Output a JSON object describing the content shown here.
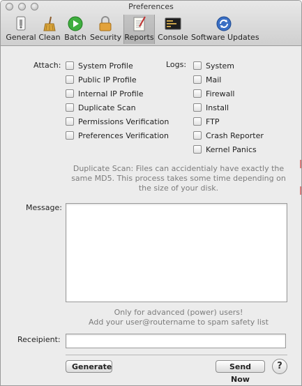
{
  "window": {
    "title": "Preferences"
  },
  "toolbar": {
    "items": [
      {
        "label": "General",
        "icon": "general-switch-icon"
      },
      {
        "label": "Clean",
        "icon": "broom-icon"
      },
      {
        "label": "Batch",
        "icon": "play-icon"
      },
      {
        "label": "Security",
        "icon": "lock-icon"
      },
      {
        "label": "Reports",
        "icon": "notepad-icon",
        "selected": true
      },
      {
        "label": "Console",
        "icon": "terminal-icon"
      },
      {
        "label": "Software Updates",
        "icon": "sync-icon"
      }
    ]
  },
  "attach": {
    "label": "Attach:",
    "options": [
      {
        "label": "System Profile",
        "checked": false
      },
      {
        "label": "Public IP Profile",
        "checked": false
      },
      {
        "label": "Internal IP Profile",
        "checked": false
      },
      {
        "label": "Duplicate Scan",
        "checked": false
      },
      {
        "label": "Permissions Verification",
        "checked": false
      },
      {
        "label": "Preferences Verification",
        "checked": false
      }
    ]
  },
  "logs": {
    "label": "Logs:",
    "options": [
      {
        "label": "System",
        "checked": false
      },
      {
        "label": "Mail",
        "checked": false
      },
      {
        "label": "Firewall",
        "checked": false
      },
      {
        "label": "Install",
        "checked": false
      },
      {
        "label": "FTP",
        "checked": false
      },
      {
        "label": "Crash Reporter",
        "checked": false
      },
      {
        "label": "Kernel Panics",
        "checked": false
      }
    ]
  },
  "duplicate_note": {
    "line1": "Duplicate Scan: Files can accidentialy have exactly the",
    "line2": "same MD5. This process takes some time depending on",
    "line3": "the size of your disk."
  },
  "message": {
    "label": "Message:",
    "value": ""
  },
  "advanced_note": {
    "line1": "Only for advanced (power) users!",
    "line2": "Add your user@routername to spam safety list"
  },
  "recipient": {
    "label": "Receipient:",
    "value": ""
  },
  "buttons": {
    "generate": "Generate",
    "send_now": "Send Now",
    "help": "?"
  }
}
